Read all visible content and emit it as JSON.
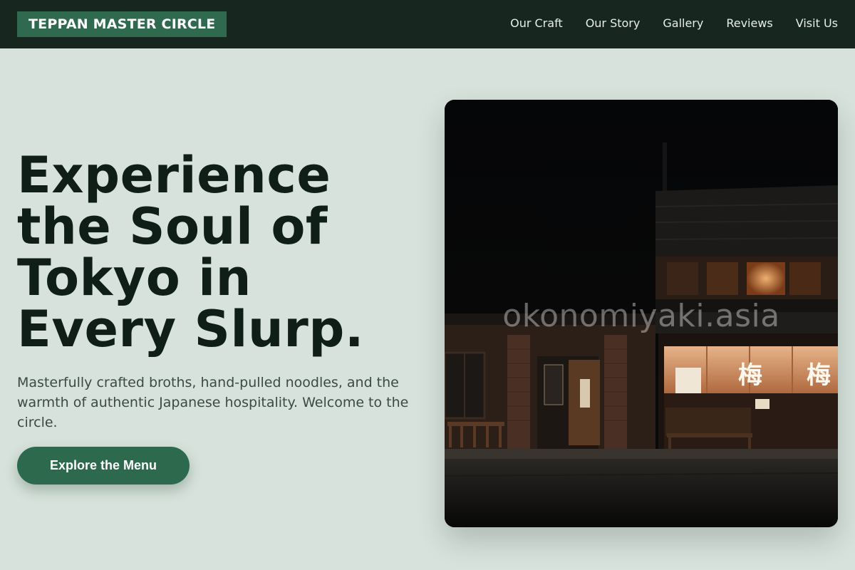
{
  "header": {
    "brand": "TEPPAN MASTER CIRCLE",
    "nav": [
      "Our Craft",
      "Our Story",
      "Gallery",
      "Reviews",
      "Visit Us"
    ]
  },
  "hero": {
    "headline_lines": [
      "Experience",
      "the Soul of",
      "Tokyo in",
      "Every Slurp."
    ],
    "lead": "Masterfully crafted broths, hand-pulled noodles, and the warmth of authentic Japanese hospitality. Welcome to the circle.",
    "cta_label": "Explore the Menu",
    "image": {
      "watermark": "okonomiyaki.asia",
      "sign_glyphs": [
        "梅",
        "梅"
      ]
    }
  },
  "colors": {
    "page_bg": "#d7e2dc",
    "header_bg": "#182620",
    "brand_bg": "#2f6a4f",
    "cta_bg": "#2d6a4d",
    "headline": "#0f1f18"
  }
}
